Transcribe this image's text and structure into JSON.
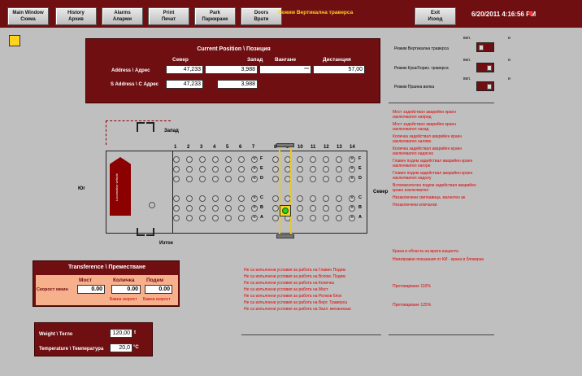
{
  "toolbar": {
    "buttons": [
      {
        "l1": "Main Window",
        "l2": "Схема"
      },
      {
        "l1": "History",
        "l2": "Архив"
      },
      {
        "l1": "Alarms",
        "l2": "Аларми"
      },
      {
        "l1": "Print",
        "l2": "Печат"
      },
      {
        "l1": "Park",
        "l2": "Паркиране"
      },
      {
        "l1": "Doors",
        "l2": "Врати"
      }
    ],
    "mode_title": "Режим Вертикална траверса",
    "exit": {
      "l1": "Exit",
      "l2": "Изход"
    },
    "datetime": "6/20/2011 4:16:56 PM"
  },
  "position": {
    "title": "Current Position \\ Позиция",
    "columns": [
      "Север",
      "Запад",
      "Вангане",
      "Дистанция"
    ],
    "address_label": "Address \\ Адрес",
    "address_values": [
      "47,233",
      "3,988",
      "***",
      "57,00"
    ],
    "saddress_label": "S Address \\ С Адрес",
    "saddress_values": [
      "47,233",
      "3,988"
    ]
  },
  "modes": {
    "on": "вкл.",
    "off": "и",
    "items": [
      "Режим Вертикална траверса",
      "Режим Кука/Хориз. траверса",
      "Режим Праина вилка"
    ]
  },
  "alarms_top": [
    "Мост задействал аварийен краен",
    "изключвател напред",
    "Мост задействал аварийен краен",
    "изключвател назад",
    "Количка задействал аварийен краен",
    "изключвател наляво",
    "Количка задействал аварийен краен",
    "изключвател надясно",
    "Главен подем задействал аварийен краен",
    "изключвател нагоре",
    "Главен подем задействал аварийен краен",
    "изключвател надолу",
    "Вспомагателен подем задействал аварийен",
    "краен изключвател",
    "Незаключени светкавица, магнитен ак",
    "Незаключени ключалки"
  ],
  "alarms_bottom": [
    "Крана в областа на врата кащилта",
    "Неизправни показания от КИ - крана в блокиран",
    "Претоварване 110%",
    "Претоварване 125%"
  ],
  "conditions": [
    "Не са изпълнени условия за работа на Главен Подем",
    "Не са изпълнени условия за работа на Вспом. Подем",
    "Не са изпълнени условия за работа на Количка",
    "Не са изпълнени условия за работа на Мост",
    "Не са изпълнени условия за работа на Ролков блок",
    "Не са изпълнени условия за работа на Верт. Траверса",
    "Не са изпълнени условия за работа на Захл. механизъм"
  ],
  "map": {
    "west": "Запад",
    "east": "Изток",
    "south": "Юг",
    "north": "Север",
    "columns": [
      "1",
      "2",
      "3",
      "4",
      "5",
      "6",
      "7",
      "8",
      "9",
      "10",
      "11",
      "12",
      "13",
      "14"
    ],
    "rows": [
      "F",
      "E",
      "D",
      "C",
      "B",
      "A"
    ],
    "vehicle_text": "Locomotive vehicle"
  },
  "transfer": {
    "title": "Transference \\ Преместване",
    "headers": [
      "Мост",
      "Количка",
      "Подем"
    ],
    "speed_label": "Скорост ммин",
    "values": [
      "0.00",
      "0.00",
      "0.00"
    ],
    "slow1": "Бавна скорост",
    "slow2": "Бавна скорост"
  },
  "weight": {
    "weight_label": "Weight \\ Тегло",
    "weight_value": "120,00",
    "weight_unit": "t",
    "temp_label": "Temperature \\ Температура",
    "temp_value": "20,0",
    "temp_unit": "°C"
  },
  "colors": {
    "maroon": "#6f0f12",
    "alarm": "#e00000",
    "yellow": "#ffd21e"
  }
}
